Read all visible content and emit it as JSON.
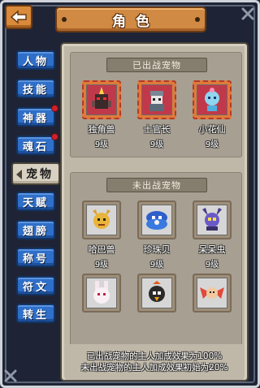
{
  "header": {
    "title": "角色",
    "back_icon": "back-arrow-icon",
    "close_icon": "close-icon"
  },
  "sidebar": {
    "items": [
      {
        "label": "人物",
        "active": false,
        "badge": false
      },
      {
        "label": "技能",
        "active": false,
        "badge": false
      },
      {
        "label": "神器",
        "active": false,
        "badge": true
      },
      {
        "label": "魂石",
        "active": false,
        "badge": true
      },
      {
        "label": "宠物",
        "active": true,
        "badge": false
      },
      {
        "label": "天赋",
        "active": false,
        "badge": false
      },
      {
        "label": "翅膀",
        "active": false,
        "badge": false
      },
      {
        "label": "称号",
        "active": false,
        "badge": false
      },
      {
        "label": "符文",
        "active": false,
        "badge": false
      },
      {
        "label": "转生",
        "active": false,
        "badge": false
      }
    ]
  },
  "deployed": {
    "header": "已出战宠物",
    "pets": [
      {
        "name": "独角兽",
        "level": "9级",
        "icon": "unicorn-beast-icon"
      },
      {
        "name": "士官长",
        "level": "9级",
        "icon": "sergeant-icon"
      },
      {
        "name": "小花仙",
        "level": "9级",
        "icon": "flower-fairy-icon"
      }
    ]
  },
  "reserve": {
    "header": "未出战宠物",
    "pets": [
      {
        "name": "哈巴兽",
        "level": "9级",
        "icon": "haba-beast-icon"
      },
      {
        "name": "珍珠贝",
        "level": "9级",
        "icon": "pearl-shell-icon"
      },
      {
        "name": "呆呆虫",
        "level": "9级",
        "icon": "daidai-bug-icon"
      },
      {
        "name": "",
        "level": "",
        "icon": "white-rabbit-icon"
      },
      {
        "name": "",
        "level": "",
        "icon": "bomb-bird-icon"
      },
      {
        "name": "",
        "level": "",
        "icon": "wing-fairy-icon"
      }
    ]
  },
  "footer": {
    "line1": "已出战宠物的主人加成效果为100%",
    "line2": "未出战宠物的主人加成效果初始为20%"
  },
  "colors": {
    "tab_blue": "#2f6fc9",
    "title_orange": "#d08a43",
    "panel_bg": "#bfb7a8",
    "badge_red": "#d0202a"
  }
}
